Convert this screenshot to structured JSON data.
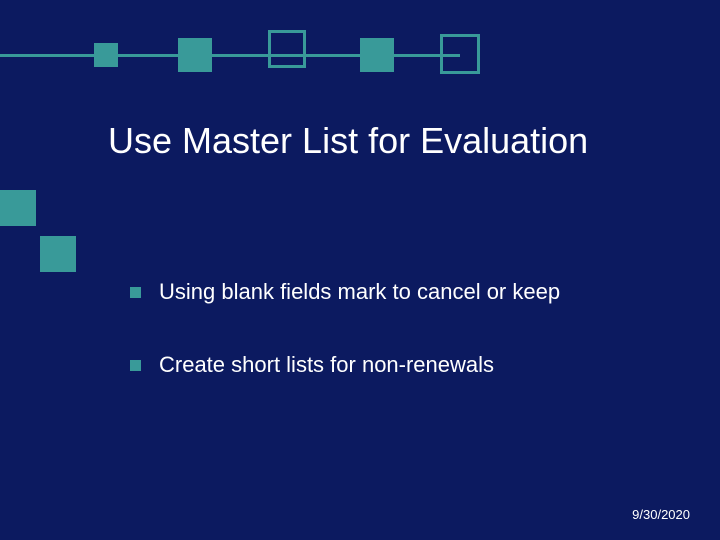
{
  "title": "Use Master List for Evaluation",
  "bullets": [
    {
      "text": "Using blank fields mark to cancel or keep"
    },
    {
      "text": "Create short lists for non-renewals"
    }
  ],
  "footer": {
    "date": "9/30/2020"
  },
  "theme": {
    "accent": "#399a99",
    "bg": "#0c1a60"
  }
}
